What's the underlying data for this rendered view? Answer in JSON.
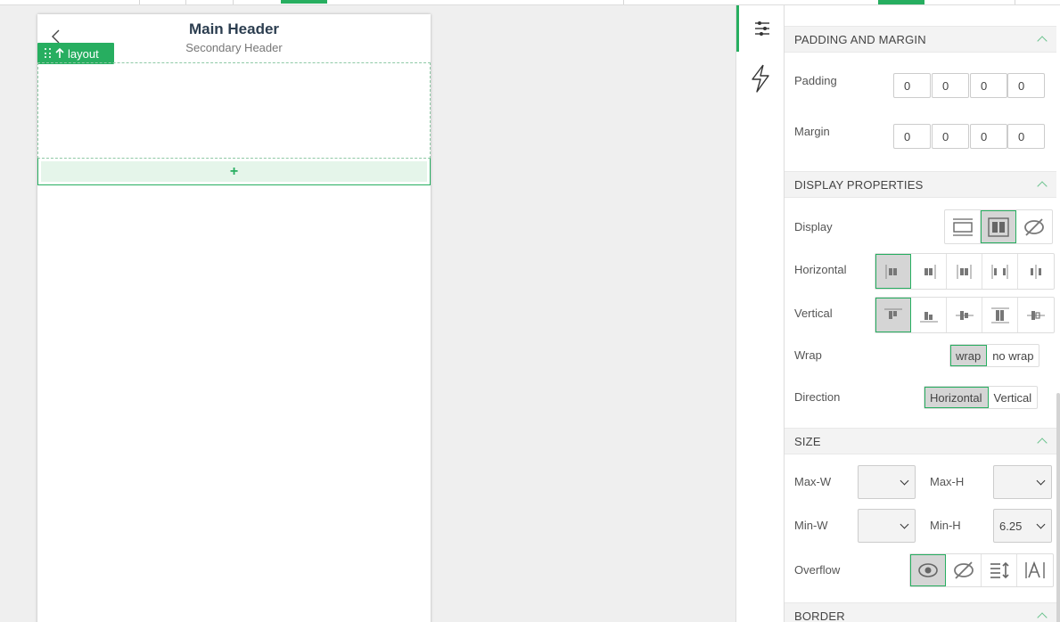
{
  "canvas": {
    "main_header": "Main Header",
    "secondary_header": "Secondary Header",
    "layout_tag": "layout",
    "add_symbol": "+"
  },
  "rail": {
    "items": [
      {
        "icon": "sliders-icon",
        "active": true
      },
      {
        "icon": "lightning-icon",
        "active": false
      }
    ]
  },
  "panel": {
    "padding_margin": {
      "title": "PADDING AND MARGIN",
      "padding_label": "Padding",
      "padding_values": [
        "0",
        "0",
        "0",
        "0"
      ],
      "margin_label": "Margin",
      "margin_values": [
        "0",
        "0",
        "0",
        "0"
      ]
    },
    "display_properties": {
      "title": "DISPLAY PROPERTIES",
      "display_label": "Display",
      "horizontal_label": "Horizontal",
      "vertical_label": "Vertical",
      "wrap_label": "Wrap",
      "wrap_options": [
        "wrap",
        "no wrap"
      ],
      "wrap_selected": "wrap",
      "direction_label": "Direction",
      "direction_options": [
        "Horizontal",
        "Vertical"
      ],
      "direction_selected": "Horizontal"
    },
    "size": {
      "title": "SIZE",
      "max_w_label": "Max-W",
      "max_w_value": "",
      "max_h_label": "Max-H",
      "max_h_value": "",
      "min_w_label": "Min-W",
      "min_w_value": "",
      "min_h_label": "Min-H",
      "min_h_value": "6.25",
      "overflow_label": "Overflow"
    },
    "border": {
      "title": "BORDER"
    }
  },
  "colors": {
    "accent": "#27ae60",
    "accent_light": "#e5f5ea",
    "selected_bg": "#d5d5d5"
  }
}
